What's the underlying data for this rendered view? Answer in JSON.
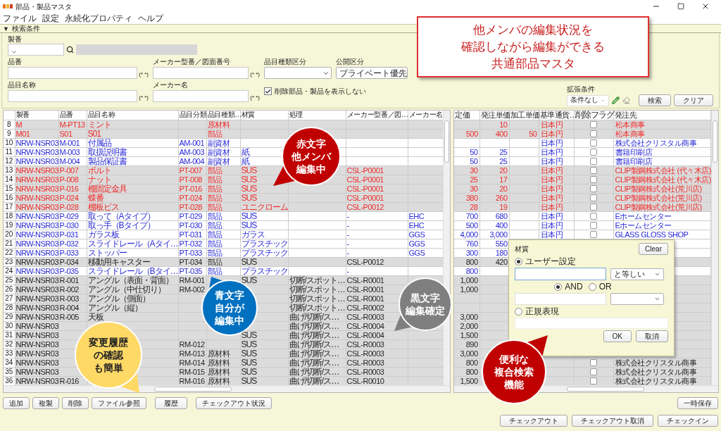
{
  "window": {
    "title": "部品・製品マスタ"
  },
  "menu": [
    "ファイル",
    "設定",
    "永続化プロパティ",
    "ヘルプ"
  ],
  "search": {
    "toggle": "▼",
    "title": "検索条件",
    "lot_label": "製番",
    "fields": [
      {
        "label": "品番",
        "kind": "text",
        "mark": "(* *)"
      },
      {
        "label": "メーカー型番／図面番号",
        "kind": "text",
        "mark": "(* *)"
      },
      {
        "label": "品目種類区分",
        "kind": "select"
      },
      {
        "label": "公開区分",
        "kind": "select",
        "value": "プライベート優先"
      },
      {
        "label": "品目名称",
        "kind": "text",
        "mark": "(* *)"
      },
      {
        "label": "メーカー名",
        "kind": "text",
        "mark": "(* *)"
      },
      {
        "label": "削除部品・製品を表示しない",
        "kind": "checkbox",
        "checked": true
      }
    ],
    "extended": {
      "label": "拡張条件",
      "value": "条件なし"
    },
    "buttons": [
      "検索",
      "クリア"
    ]
  },
  "annotation": [
    "他メンバの編集状況を",
    "確認しながら編集ができる",
    "共通部品マスタ"
  ],
  "left_columns": [
    "製番",
    "品番",
    "品目名称",
    "品目分類",
    "品目種類…",
    "材質",
    "処理",
    "メーカー型番／図…",
    "メーカー名"
  ],
  "right_columns": [
    "定価",
    "発注単価",
    "加工単価",
    "基準通貨…",
    "削除フラグ",
    "発注先"
  ],
  "rows": [
    {
      "no": "8",
      "kind": "other",
      "left": {
        "lot": "M",
        "part": "M-PT13",
        "name": "ミント",
        "type": "原材料"
      },
      "right": {
        "order": "10",
        "currency": "日本円",
        "supplier": "松本商事"
      },
      "deleted": false
    },
    {
      "no": "9",
      "kind": "other",
      "left": {
        "lot": "M01",
        "part": "S01",
        "name": "S01",
        "type": "部品"
      },
      "right": {
        "price": "500",
        "order": "400",
        "proc": "50",
        "currency": "日本円",
        "supplier": "松本商事"
      },
      "deleted": false
    },
    {
      "no": "10",
      "kind": "self",
      "left": {
        "lot": "NRW-NSR03",
        "part": "M-001",
        "name": "付属品",
        "cls": "AM-001",
        "type": "副資材"
      },
      "right": {
        "currency": "日本円",
        "supplier": "株式会社クリスタル商事"
      },
      "deleted": false
    },
    {
      "no": "11",
      "kind": "self",
      "left": {
        "lot": "NRW-NSR03",
        "part": "M-003",
        "name": "取扱説明書",
        "cls": "AM-003",
        "type": "副資材",
        "material": "紙"
      },
      "right": {
        "price": "50",
        "order": "25",
        "currency": "日本円",
        "supplier": "書籍印刷店"
      },
      "deleted": false
    },
    {
      "no": "12",
      "kind": "self",
      "left": {
        "lot": "NRW-NSR03",
        "part": "M-004",
        "name": "製品保証書",
        "cls": "AM-004",
        "type": "副資材",
        "material": "紙"
      },
      "right": {
        "price": "50",
        "order": "25",
        "currency": "日本円",
        "supplier": "書籍印刷店"
      },
      "deleted": false
    },
    {
      "no": "13",
      "kind": "other",
      "left": {
        "lot": "NRW-NSR03",
        "part": "P-007",
        "name": "ボルト",
        "cls": "PT-007",
        "type": "部品",
        "material": "SUS",
        "maker_part": "CSL-P0001"
      },
      "right": {
        "price": "30",
        "order": "20",
        "currency": "日本円",
        "supplier": "CLIP製鋼株式会社 (代々木店)"
      },
      "deleted": false
    },
    {
      "no": "14",
      "kind": "other",
      "left": {
        "lot": "NRW-NSR03",
        "part": "P-008",
        "name": "ナット",
        "cls": "PT-008",
        "type": "部品",
        "material": "SUS",
        "maker_part": "CSL-P0001"
      },
      "right": {
        "price": "25",
        "order": "17",
        "currency": "日本円",
        "supplier": "CLIP製鋼株式会社 (代々木店)"
      },
      "deleted": false
    },
    {
      "no": "15",
      "kind": "other",
      "left": {
        "lot": "NRW-NSR03",
        "part": "P-016",
        "name": "棚固定金具",
        "cls": "PT-016",
        "type": "部品",
        "material": "SUS",
        "maker_part": "CSL-P0001"
      },
      "right": {
        "price": "30",
        "order": "20",
        "currency": "日本円",
        "supplier": "CLIP製鋼株式会社(荒川店)"
      },
      "deleted": false
    },
    {
      "no": "16",
      "kind": "other",
      "left": {
        "lot": "NRW-NSR03",
        "part": "P-024",
        "name": "蝶番",
        "cls": "PT-024",
        "type": "部品",
        "material": "SUS",
        "maker_part": "CSL-P0001"
      },
      "right": {
        "price": "380",
        "order": "260",
        "currency": "日本円",
        "supplier": "CLIP製鋼株式会社(荒川店)"
      },
      "deleted": false
    },
    {
      "no": "17",
      "kind": "other",
      "left": {
        "lot": "NRW-NSR03",
        "part": "P-028",
        "name": "棚板ビス",
        "cls": "PT-028",
        "type": "部品",
        "material": "ユニクローム",
        "maker_part": "CSL-P0012"
      },
      "right": {
        "price": "28",
        "order": "19",
        "currency": "日本円",
        "supplier": "CLIP製鋼株式会社(荒川店)"
      },
      "deleted": false
    },
    {
      "no": "18",
      "kind": "self",
      "left": {
        "lot": "NRW-NSR03",
        "part": "P-029",
        "name": "取って（Aタイプ）",
        "cls": "PT-029",
        "type": "部品",
        "material": "SUS",
        "maker_part": "-",
        "maker": "EHC"
      },
      "right": {
        "price": "700",
        "order": "680",
        "currency": "日本円",
        "supplier": "Eホームセンター"
      },
      "deleted": false
    },
    {
      "no": "19",
      "kind": "self",
      "left": {
        "lot": "NRW-NSR03",
        "part": "P-030",
        "name": "取っ手（Bタイプ）",
        "cls": "PT-030",
        "type": "部品",
        "material": "SUS",
        "maker_part": "-",
        "maker": "EHC"
      },
      "right": {
        "price": "500",
        "order": "400",
        "currency": "日本円",
        "supplier": "Eホームセンター"
      },
      "deleted": false
    },
    {
      "no": "20",
      "kind": "self",
      "left": {
        "lot": "NRW-NSR03",
        "part": "P-031",
        "name": "ガラス板",
        "cls": "PT-031",
        "type": "部品",
        "material": "ガラス",
        "maker_part": "-",
        "maker": "GGS"
      },
      "right": {
        "price": "4,000",
        "order": "3,000",
        "currency": "日本円",
        "supplier": "GLASS GLOSS SHOP"
      },
      "deleted": false
    },
    {
      "no": "21",
      "kind": "self",
      "left": {
        "lot": "NRW-NSR03",
        "part": "P-032",
        "name": "スライドレール（Aタイ…",
        "cls": "PT-032",
        "type": "部品",
        "material": "プラスチック",
        "maker_part": "-",
        "maker": "GGS"
      },
      "right": {
        "price": "760",
        "order": "550"
      }
    },
    {
      "no": "22",
      "kind": "self",
      "left": {
        "lot": "NRW-NSR03",
        "part": "P-033",
        "name": "ストッパー",
        "cls": "PT-033",
        "type": "部品",
        "material": "プラスチック",
        "maker_part": "-",
        "maker": "GGS"
      },
      "right": {
        "price": "300",
        "order": "180"
      }
    },
    {
      "no": "23",
      "kind": "done",
      "left": {
        "lot": "NRW-NSR03",
        "part": "P-034",
        "name": "移動用キャスター",
        "cls": "PT-034",
        "type": "部品",
        "material": "SUS",
        "maker_part": "CSL-P0012"
      },
      "right": {
        "price": "800",
        "order": "420"
      }
    },
    {
      "no": "24",
      "kind": "self",
      "left": {
        "lot": "NRW-NSR03",
        "part": "P-035",
        "name": "スライドレール（Bタイ…",
        "cls": "PT-035",
        "type": "部品",
        "material": "プラスチック",
        "maker_part": "-"
      },
      "right": {
        "price": "800"
      }
    },
    {
      "no": "25",
      "kind": "done",
      "left": {
        "lot": "NRW-NSR03",
        "part": "R-001",
        "name": "アングル（表面・背面）",
        "cls": "RM-001",
        "material": "SUS",
        "process": "切断/スポット…",
        "maker_part": "CSL-R0001"
      },
      "right": {
        "price": "1,000"
      }
    },
    {
      "no": "26",
      "kind": "done",
      "left": {
        "lot": "NRW-NSR03",
        "part": "R-002",
        "name": "アングル（中仕切り）",
        "cls": "RM-002",
        "process": "切断/スポット…",
        "maker_part": "CSL-R0001"
      },
      "right": {
        "price": "1,000"
      }
    },
    {
      "no": "27",
      "kind": "done",
      "left": {
        "lot": "NRW-NSR03",
        "part": "R-003",
        "name": "アングル（側面）",
        "process": "切断/スポット…",
        "maker_part": "CSL-R0001"
      },
      "right": {}
    },
    {
      "no": "28",
      "kind": "done",
      "left": {
        "lot": "NRW-NSR03",
        "part": "R-004",
        "name": "アングル（縦）",
        "process": "切断/スポット…",
        "maker_part": "CSL-R0002"
      },
      "right": {}
    },
    {
      "no": "29",
      "kind": "done",
      "left": {
        "lot": "NRW-NSR03",
        "part": "R-005",
        "name": "天板",
        "process": "曲げ/切断/ス…",
        "maker_part": "CSL-R0003"
      },
      "right": {
        "price": "3,000"
      }
    },
    {
      "no": "30",
      "kind": "done",
      "left": {
        "lot": "NRW-NSR03",
        "process": "曲げ/切断/ス…",
        "maker_part": "CSL-R0004"
      },
      "right": {
        "price": "2,000"
      }
    },
    {
      "no": "31",
      "kind": "done",
      "left": {
        "lot": "NRW-NSR03",
        "material": "SUS",
        "process": "曲げ/切断/ス…",
        "maker_part": "CSL-R0004"
      },
      "right": {
        "price": "1,500"
      }
    },
    {
      "no": "32",
      "kind": "done",
      "left": {
        "lot": "NRW-NSR03",
        "cls": "RM-012",
        "material": "SUS",
        "process": "曲げ/切断/ス…",
        "maker_part": "CSL-R0003"
      },
      "right": {
        "price": "890"
      }
    },
    {
      "no": "33",
      "kind": "done",
      "left": {
        "lot": "NRW-NSR03",
        "cls": "RM-013",
        "type": "原材料",
        "material": "SUS",
        "process": "曲げ/切断/ス…",
        "maker_part": "CSL-R0003"
      },
      "right": {
        "price": "3,000"
      }
    },
    {
      "no": "34",
      "kind": "done",
      "left": {
        "lot": "NRW-NSR03",
        "cls": "RM-014",
        "type": "原材料",
        "material": "SUS",
        "process": "曲げ/切断/ス…",
        "maker_part": "CSL-R0003"
      },
      "right": {
        "price": "800",
        "supplier": "株式会社クリスタル商事"
      },
      "deleted": false
    },
    {
      "no": "35",
      "kind": "done",
      "left": {
        "lot": "NRW-NSR03",
        "cls": "RM-015",
        "type": "原材料",
        "material": "SUS",
        "process": "曲げ/切断/ス…",
        "maker_part": "CSL-R0003"
      },
      "right": {
        "price": "800",
        "supplier": "株式会社クリスタル商事"
      },
      "deleted": false
    },
    {
      "no": "36",
      "kind": "done",
      "left": {
        "lot": "NRW-NSR03",
        "part": "R-016",
        "cls": "RM-016",
        "type": "原材料",
        "material": "SUS",
        "process": "曲げ/切断/ス…",
        "maker_part": "CSL-R0010"
      },
      "right": {
        "price": "1,500",
        "supplier": "株式会社クリスタル商事"
      },
      "deleted": false
    }
  ],
  "actions": [
    "追加",
    "複製",
    "削除",
    "ファイル参照",
    "履歴",
    "チェックアウト状況"
  ],
  "save_button": "一時保存",
  "checkout_buttons": [
    "チェックアウト",
    "チェックアウト取消",
    "チェックイン"
  ],
  "filter_popup": {
    "title": "材質",
    "clear": "Clear",
    "modes": [
      {
        "label": "ユーザー設定",
        "selected": true
      },
      {
        "label": "正規表現",
        "selected": false
      }
    ],
    "operator": "と等しい",
    "logic": [
      {
        "label": "AND",
        "selected": true
      },
      {
        "label": "OR",
        "selected": false
      }
    ],
    "buttons": [
      "OK",
      "取消"
    ]
  },
  "callouts": [
    {
      "lines": [
        "赤文字",
        "他メンバ",
        "編集中"
      ],
      "color": "#c00000",
      "kind": "dark"
    },
    {
      "lines": [
        "青文字",
        "自分が",
        "編集中"
      ],
      "color": "#0070c0",
      "kind": "dark"
    },
    {
      "lines": [
        "黒文字",
        "編集確定"
      ],
      "color": "#7f7f7f",
      "kind": "dark"
    },
    {
      "lines": [
        "変更履歴",
        "の確認",
        "も簡単"
      ],
      "color": "#ffd966",
      "kind": "light"
    },
    {
      "lines": [
        "便利な",
        "複合検索",
        "機能"
      ],
      "color": "#c00000",
      "kind": "dark"
    }
  ]
}
